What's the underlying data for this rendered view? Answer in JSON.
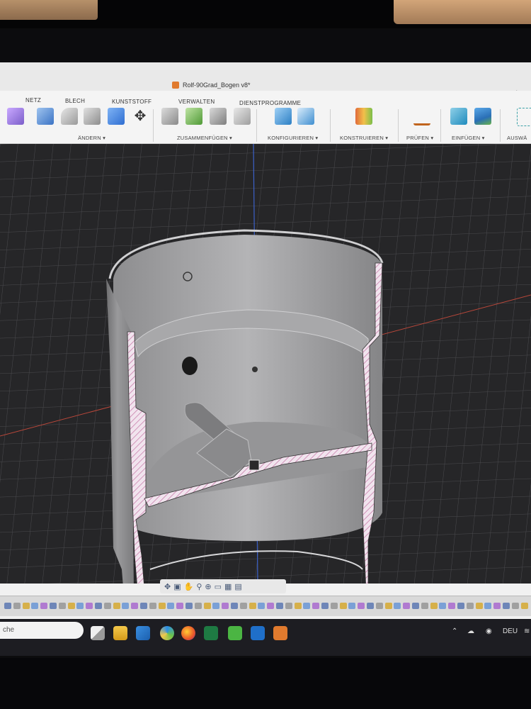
{
  "window": {
    "document_title": "Rolf-90Grad_Bogen v8*",
    "close_tab": "×",
    "add_tab": "+"
  },
  "ribbon": {
    "tabs": [
      "NETZ",
      "BLECH",
      "KUNSTSTOFF",
      "VERWALTEN",
      "DIENSTPROGRAMME"
    ],
    "groups": [
      "ÄNDERN ▾",
      "ZUSAMMENFÜGEN ▾",
      "KONFIGURIEREN ▾",
      "KONSTRUIEREN ▾",
      "PRÜFEN ▾",
      "EINFÜGEN ▾",
      "AUSWÄ"
    ]
  },
  "viewport": {
    "model": "cut-away pipe section with internal disc and shaft"
  },
  "nav_toolbar": {
    "icons": [
      "orbit-icon",
      "pan-icon",
      "look-at-icon",
      "zoom-icon",
      "zoom-window-icon",
      "display-settings-icon",
      "grid-icon",
      "viewports-icon"
    ],
    "glyphs": [
      "✥",
      "▣",
      "✋",
      "⚲",
      "⊕",
      "▭",
      "▦",
      "▤"
    ]
  },
  "taskbar": {
    "search_text": "che",
    "language": "DEU"
  },
  "colors": {
    "accent": "#e07a2e",
    "viewport_bg": "#262628",
    "section_hatch": "#c77aa8",
    "axis_red": "#b8473a",
    "axis_blue": "#3c61c9"
  }
}
